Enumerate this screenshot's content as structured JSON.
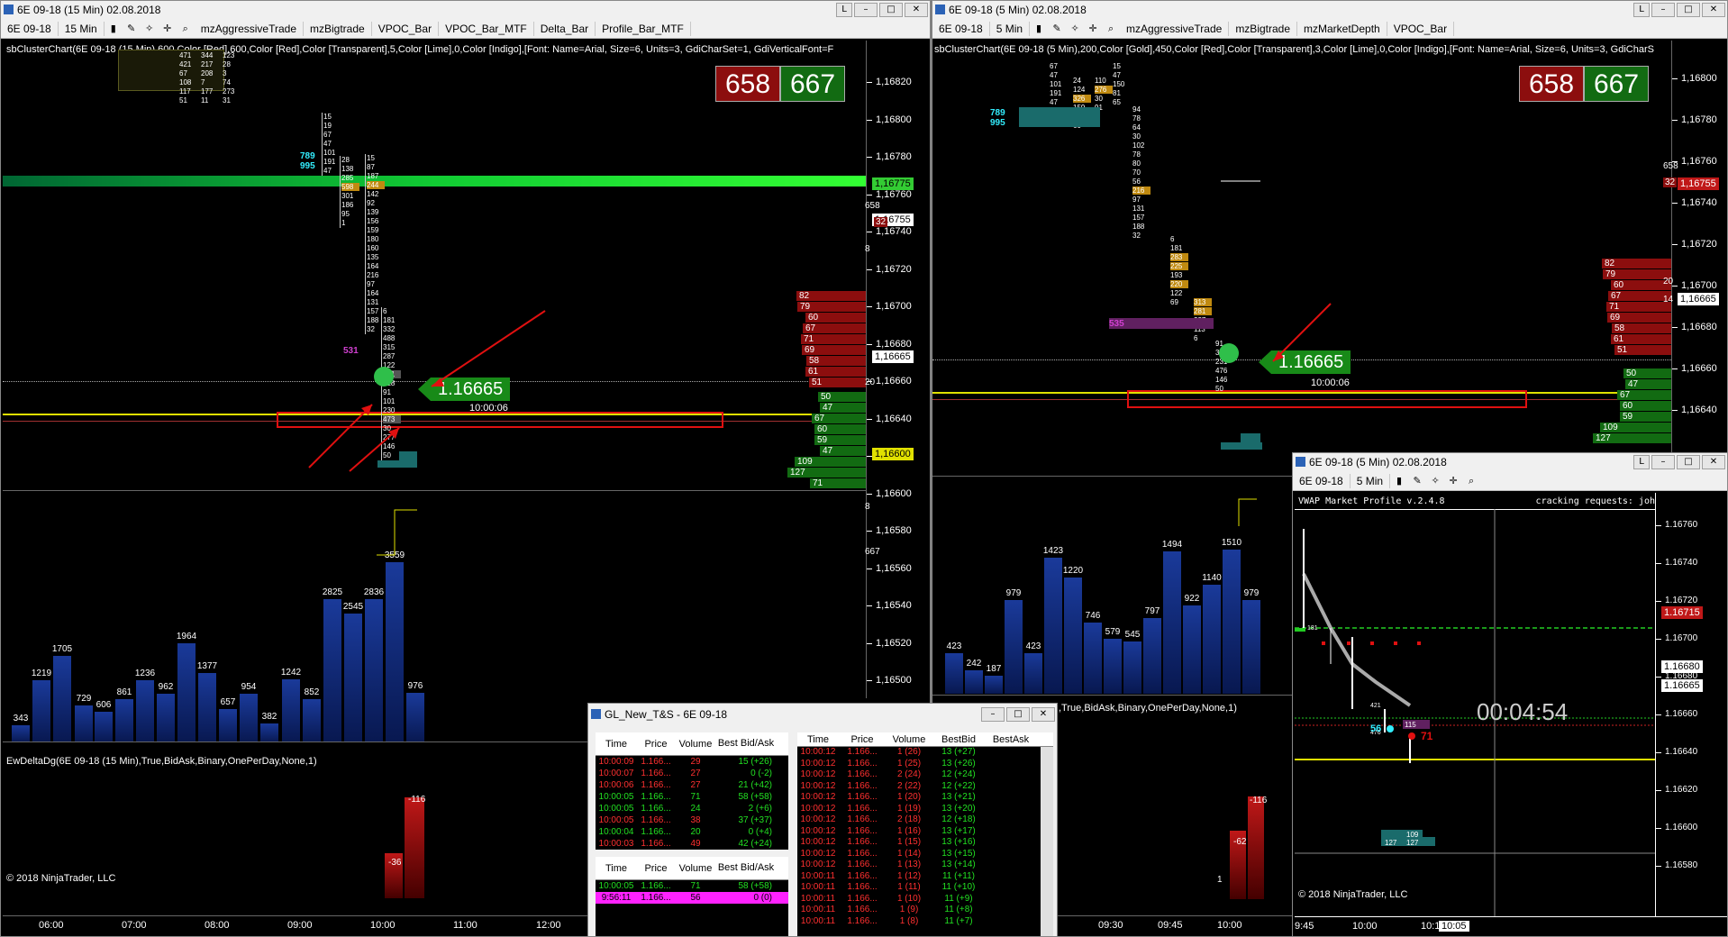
{
  "colors": {
    "bid": "#c01818",
    "ask": "#1a8a1a",
    "volume": "#14297a",
    "highlight": "#e0e000"
  },
  "left": {
    "title": "6E 09-18 (15 Min)  02.08.2018",
    "toolbar": [
      "6E 09-18",
      "15 Min",
      "mzAggressiveTrade",
      "mzBigtrade",
      "VPOC_Bar",
      "VPOC_Bar_MTF",
      "Delta_Bar",
      "Profile_Bar_MTF"
    ],
    "indicator": "sbClusterChart(6E 09-18 (15 Min),600,Color [Red],600,Color [Red],Color [Transparent],5,Color [Lime],0,Color [Indigo],[Font: Name=Arial, Size=6, Units=3, GdiCharSet=1, GdiVerticalFont=F",
    "bid_box": "658",
    "ask_box": "667",
    "price_tag": "1.16665",
    "time_tag": "10:00:06",
    "yticks": [
      "1,16820",
      "1,16800",
      "1,16780",
      "1,16760",
      "1,16740",
      "1,16720",
      "1,16700",
      "1,16680",
      "1,16660",
      "1,16640",
      "1,16620",
      "1,16600",
      "1,16580",
      "1,16560",
      "1,16540",
      "1,16520",
      "1,16500"
    ],
    "axis_tags": [
      "1,16775",
      "1,16755",
      "1,16665",
      "1,16600"
    ],
    "axis_small": [
      "658",
      "32",
      "8",
      "20",
      "8",
      "667"
    ],
    "ladder_bid": [
      "82",
      "79",
      "60",
      "67",
      "71",
      "69",
      "58",
      "61",
      "51"
    ],
    "ladder_ask": [
      "50",
      "47",
      "67",
      "60",
      "59",
      "47",
      "109",
      "127",
      "71"
    ],
    "volumes": [
      "343",
      "1219",
      "1705",
      "729",
      "606",
      "861",
      "1236",
      "962",
      "1964",
      "1377",
      "657",
      "954",
      "382",
      "1242",
      "852",
      "2825",
      "2545",
      "2836",
      "3559",
      "976"
    ],
    "delta_label": "EwDeltaDg(6E 09-18 (15 Min),True,BidAsk,Binary,OnePerDay,None,1)",
    "delta_vals": [
      "-116",
      "-36"
    ],
    "copyright": "© 2018 NinjaTrader, LLC",
    "xticks": [
      "06:00",
      "07:00",
      "08:00",
      "09:00",
      "10:00",
      "11:00",
      "12:00"
    ],
    "clusters": [
      "15",
      "19",
      "67",
      "47",
      "101",
      "191",
      "47",
      "28",
      "138",
      "285",
      "598",
      "301",
      "186",
      "95",
      "1",
      "15",
      "87",
      "187",
      "244",
      "142",
      "92",
      "139",
      "156",
      "159",
      "180",
      "160",
      "135",
      "164",
      "216",
      "97",
      "164",
      "131",
      "157",
      "188",
      "32",
      "6",
      "181",
      "332",
      "488",
      "315",
      "287",
      "122",
      "531",
      "428",
      "91",
      "101",
      "230",
      "473",
      "30",
      "277",
      "146",
      "50"
    ],
    "top_nums": [
      "471",
      "421",
      "67",
      "108",
      "117",
      "51",
      "344",
      "217",
      "208",
      "7",
      "177",
      "11",
      "123",
      "28",
      "3",
      "74",
      "273",
      "31"
    ],
    "side_vals": [
      "789",
      "995",
      "531"
    ]
  },
  "right": {
    "title": "6E 09-18 (5 Min)  02.08.2018",
    "toolbar": [
      "6E 09-18",
      "5 Min",
      "mzAggressiveTrade",
      "mzBigtrade",
      "mzMarketDepth",
      "VPOC_Bar"
    ],
    "indicator": "sbClusterChart(6E 09-18 (5 Min),200,Color [Gold],450,Color [Red],Color [Transparent],3,Color [Lime],0,Color [Indigo],[Font: Name=Arial, Size=6, Units=3, GdiCharS",
    "bid_box": "658",
    "ask_box": "667",
    "price_tag": "1.16665",
    "time_tag": "10:00:06",
    "yticks": [
      "1,16800",
      "1,16780",
      "1,16760",
      "1,16740",
      "1,16720",
      "1,16700",
      "1,16680",
      "1,16660",
      "1,16640"
    ],
    "axis_tags": [
      "1,16755",
      "1,16665"
    ],
    "axis_small": [
      "658",
      "32",
      "14",
      "20"
    ],
    "ladder_bid": [
      "82",
      "79",
      "60",
      "67",
      "71",
      "69",
      "58",
      "61",
      "51"
    ],
    "ladder_ask": [
      "50",
      "47",
      "67",
      "60",
      "59",
      "109",
      "127"
    ],
    "volumes": [
      "423",
      "242",
      "187",
      "979",
      "423",
      "1423",
      "1220",
      "746",
      "579",
      "545",
      "797",
      "1494",
      "922",
      "1140",
      "1510",
      "979"
    ],
    "delta_label": ",True,BidAsk,Binary,OnePerDay,None,1)",
    "delta_vals": [
      "-62",
      "-116",
      "1"
    ],
    "xticks": [
      "09:30",
      "09:45",
      "10:00"
    ],
    "side_vals": [
      "789",
      "995",
      "535"
    ]
  },
  "ts": {
    "title": "GL_New_T&S - 6E 09-18",
    "headers": [
      "Time",
      "Price",
      "Volume",
      "Best Bid/Ask"
    ],
    "rows_a": [
      {
        "t": "10:00:09",
        "p": "1.166...",
        "v": "29",
        "b": "15 (+26)",
        "c": "red"
      },
      {
        "t": "10:00:07",
        "p": "1.166...",
        "v": "27",
        "b": "0 (-2)",
        "c": "red"
      },
      {
        "t": "10:00:06",
        "p": "1.166...",
        "v": "27",
        "b": "21 (+42)",
        "c": "red"
      },
      {
        "t": "10:00:05",
        "p": "1.166...",
        "v": "71",
        "b": "58 (+58)",
        "c": "green"
      },
      {
        "t": "10:00:05",
        "p": "1.166...",
        "v": "24",
        "b": "2 (+6)",
        "c": "green"
      },
      {
        "t": "10:00:05",
        "p": "1.166...",
        "v": "38",
        "b": "37 (+37)",
        "c": "red"
      },
      {
        "t": "10:00:04",
        "p": "1.166...",
        "v": "20",
        "b": "0 (+4)",
        "c": "green"
      },
      {
        "t": "10:00:03",
        "p": "1.166...",
        "v": "49",
        "b": "42 (+24)",
        "c": "red"
      }
    ],
    "rows_b": [
      {
        "t": "10:00:05",
        "p": "1.166...",
        "v": "71",
        "b": "58 (+58)",
        "c": "green"
      },
      {
        "t": "9:56:11",
        "p": "1.166...",
        "v": "56",
        "b": "0 (0)",
        "c": "magenta"
      }
    ],
    "headers2": [
      "Time",
      "Price",
      "Volume",
      "BestBid",
      "BestAsk"
    ],
    "rows_c": [
      [
        "10:00:12",
        "1.166...",
        "1 (26)",
        "13 (+27)"
      ],
      [
        "10:00:12",
        "1.166...",
        "1 (25)",
        "13 (+26)"
      ],
      [
        "10:00:12",
        "1.166...",
        "2 (24)",
        "12 (+24)"
      ],
      [
        "10:00:12",
        "1.166...",
        "2 (22)",
        "12 (+22)"
      ],
      [
        "10:00:12",
        "1.166...",
        "1 (20)",
        "13 (+21)"
      ],
      [
        "10:00:12",
        "1.166...",
        "1 (19)",
        "13 (+20)"
      ],
      [
        "10:00:12",
        "1.166...",
        "2 (18)",
        "12 (+18)"
      ],
      [
        "10:00:12",
        "1.166...",
        "1 (16)",
        "13 (+17)"
      ],
      [
        "10:00:12",
        "1.166...",
        "1 (15)",
        "13 (+16)"
      ],
      [
        "10:00:12",
        "1.166...",
        "1 (14)",
        "13 (+15)"
      ],
      [
        "10:00:12",
        "1.166...",
        "1 (13)",
        "13 (+14)"
      ],
      [
        "10:00:11",
        "1.166...",
        "1 (12)",
        "11 (+11)"
      ],
      [
        "10:00:11",
        "1.166...",
        "1 (11)",
        "11 (+10)"
      ],
      [
        "10:00:11",
        "1.166...",
        "1 (10)",
        "11 (+9)"
      ],
      [
        "10:00:11",
        "1.166...",
        "1 (9)",
        "11 (+8)"
      ],
      [
        "10:00:11",
        "1.166...",
        "1 (8)",
        "11 (+7)"
      ]
    ]
  },
  "vwap": {
    "title": "6E 09-18 (5 Min)  02.08.2018",
    "toolbar": [
      "6E 09-18",
      "5 Min"
    ],
    "header_left": "VWAP Market Profile v.2.4.8",
    "header_right": "cracking requests: joh",
    "yticks": [
      "1.16760",
      "1.16740",
      "1.16720",
      "1.16700",
      "1.16680",
      "1.16660",
      "1.16640",
      "1.16620",
      "1.16600",
      "1.16580"
    ],
    "axis_tags": [
      "1.16715",
      "1.16680",
      "1.16665"
    ],
    "countdown": "00:04:54",
    "labels": [
      "181",
      "421",
      "476",
      "56",
      "71",
      "115",
      "109",
      "127",
      "127"
    ],
    "xticks": [
      "9:45",
      "10:00",
      "10:15"
    ],
    "xtag": "10:05",
    "copyright": "© 2018 NinjaTrader, LLC"
  }
}
